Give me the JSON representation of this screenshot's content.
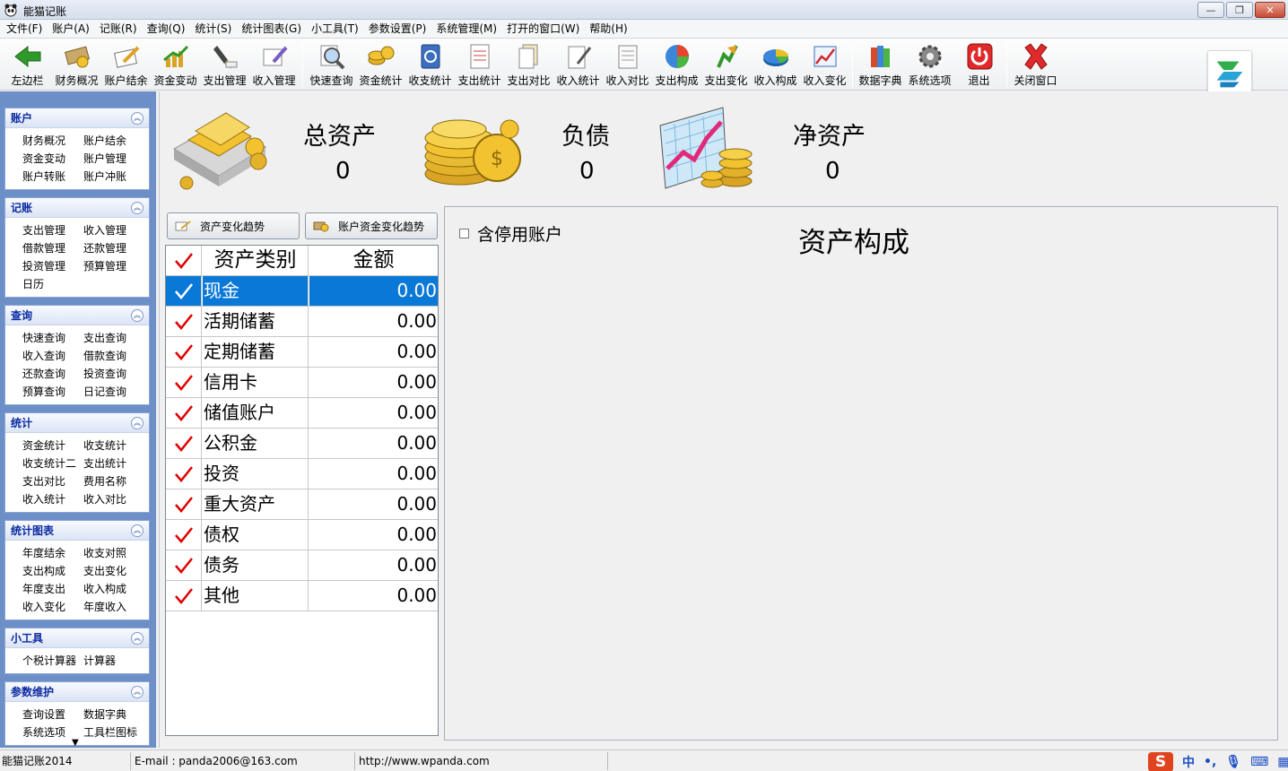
{
  "window": {
    "title": "能猫记账"
  },
  "menu": [
    "文件(F)",
    "账户(A)",
    "记账(R)",
    "查询(Q)",
    "统计(S)",
    "统计图表(G)",
    "小工具(T)",
    "参数设置(P)",
    "系统管理(M)",
    "打开的窗口(W)",
    "帮助(H)"
  ],
  "toolbar": {
    "buttons": [
      "左边栏",
      "财务概况",
      "账户结余",
      "资金变动",
      "支出管理",
      "收入管理",
      "快速查询",
      "资金统计",
      "收支统计",
      "支出统计",
      "支出对比",
      "收入统计",
      "收入对比",
      "支出构成",
      "支出变化",
      "收入构成",
      "收入变化",
      "数据字典",
      "系统选项",
      "退出",
      "关闭窗口"
    ]
  },
  "sidebar": {
    "groups": [
      {
        "title": "账户",
        "items": [
          "财务概况",
          "账户结余",
          "资金变动",
          "账户管理",
          "账户转账",
          "账户冲账"
        ]
      },
      {
        "title": "记账",
        "items": [
          "支出管理",
          "收入管理",
          "借款管理",
          "还款管理",
          "投资管理",
          "预算管理",
          "日历"
        ]
      },
      {
        "title": "查询",
        "items": [
          "快速查询",
          "支出查询",
          "收入查询",
          "借款查询",
          "还款查询",
          "投资查询",
          "预算查询",
          "日记查询"
        ]
      },
      {
        "title": "统计",
        "items": [
          "资金统计",
          "收支统计",
          "收支统计二",
          "支出统计",
          "支出对比",
          "费用名称",
          "收入统计",
          "收入对比"
        ]
      },
      {
        "title": "统计图表",
        "items": [
          "年度结余",
          "收支对照",
          "支出构成",
          "支出变化",
          "年度支出",
          "收入构成",
          "收入变化",
          "年度收入"
        ]
      },
      {
        "title": "小工具",
        "items": [
          "个税计算器",
          "计算器"
        ]
      },
      {
        "title": "参数维护",
        "items": [
          "查询设置",
          "数据字典",
          "系统选项",
          "工具栏图标"
        ]
      }
    ]
  },
  "summary": {
    "total_assets": {
      "label": "总资产",
      "value": "0"
    },
    "liabilities": {
      "label": "负债",
      "value": "0"
    },
    "net_assets": {
      "label": "净资产",
      "value": "0"
    }
  },
  "trend_buttons": {
    "asset_trend": "资产变化趋势",
    "account_trend": "账户资金变化趋势"
  },
  "grid": {
    "headers": {
      "category": "资产类别",
      "amount": "金额"
    },
    "rows": [
      {
        "category": "现金",
        "amount": "0.00",
        "selected": true
      },
      {
        "category": "活期储蓄",
        "amount": "0.00"
      },
      {
        "category": "定期储蓄",
        "amount": "0.00"
      },
      {
        "category": "信用卡",
        "amount": "0.00"
      },
      {
        "category": "储值账户",
        "amount": "0.00"
      },
      {
        "category": "公积金",
        "amount": "0.00"
      },
      {
        "category": "投资",
        "amount": "0.00"
      },
      {
        "category": "重大资产",
        "amount": "0.00"
      },
      {
        "category": "债权",
        "amount": "0.00"
      },
      {
        "category": "债务",
        "amount": "0.00"
      },
      {
        "category": "其他",
        "amount": "0.00"
      }
    ]
  },
  "chart_panel": {
    "include_disabled_label": "含停用账户",
    "title": "资产构成"
  },
  "status": {
    "app_version": "能猫记账2014",
    "email": "E-mail : panda2006@163.com",
    "website": "http://www.wpanda.com"
  },
  "ime": {
    "logo": "S",
    "mode": "中"
  },
  "colors": {
    "selection": "#0a78d7",
    "sidebar_bg": "#6d8fc7",
    "check": "#e00000"
  }
}
